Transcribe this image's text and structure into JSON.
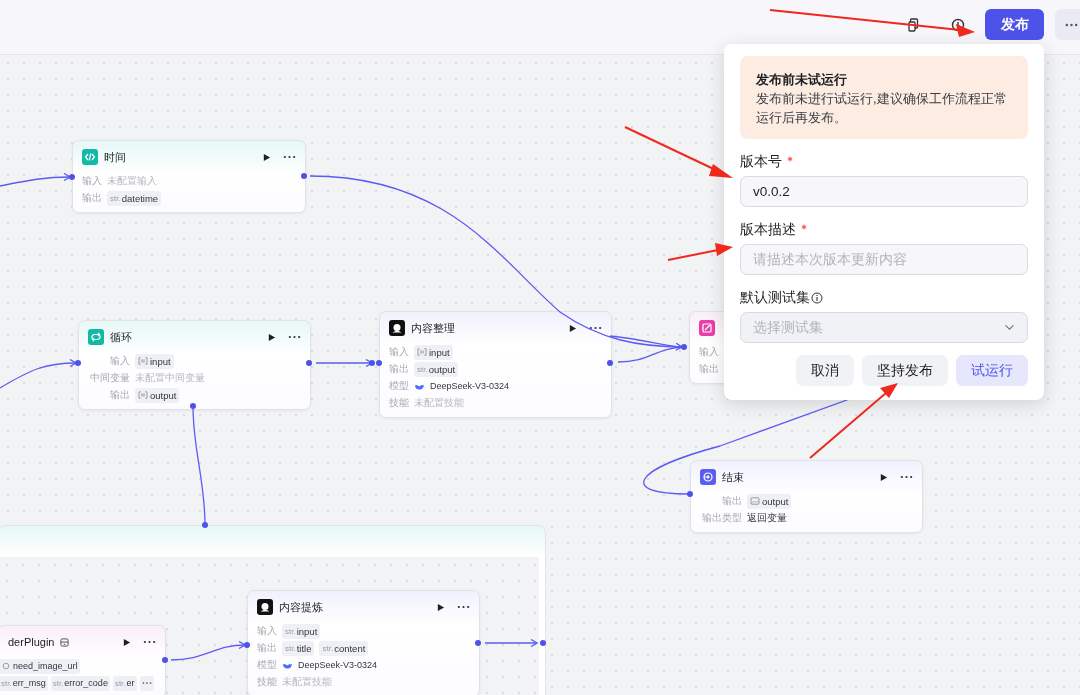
{
  "toolbar": {
    "publish_button": "发布"
  },
  "nodes": [
    {
      "kind": "code",
      "title": "时间",
      "rows": [
        {
          "label": "输入",
          "kind": "empty",
          "value": "未配置输入"
        },
        {
          "label": "输出",
          "kind": "tags",
          "tags": [
            {
              "kind": "str",
              "prefix": "str.",
              "name": "datetime"
            }
          ]
        }
      ]
    },
    {
      "kind": "loop",
      "title": "循环",
      "rows": [
        {
          "label": "输入",
          "kind": "tags",
          "tags": [
            {
              "kind": "array",
              "name": "input"
            }
          ]
        },
        {
          "label": "中间变量",
          "kind": "empty",
          "value": "未配置中间变量"
        },
        {
          "label": "输出",
          "kind": "tags",
          "tags": [
            {
              "kind": "array",
              "name": "output"
            }
          ]
        }
      ]
    },
    {
      "kind": "llm",
      "title": "内容整理",
      "rows": [
        {
          "label": "输入",
          "kind": "tags",
          "tags": [
            {
              "kind": "array",
              "name": "input"
            }
          ]
        },
        {
          "label": "输出",
          "kind": "tags",
          "tags": [
            {
              "kind": "str",
              "prefix": "str.",
              "name": "output"
            }
          ]
        },
        {
          "label": "模型",
          "kind": "model",
          "value": "DeepSeek-V3-0324"
        },
        {
          "label": "技能",
          "kind": "empty",
          "value": "未配置技能"
        }
      ]
    },
    {
      "kind": "image",
      "rows": [
        {
          "label": "输入"
        },
        {
          "label": "输出"
        }
      ]
    },
    {
      "kind": "end",
      "title": "结束",
      "rows": [
        {
          "label": "输出",
          "kind": "tags",
          "tags": [
            {
              "kind": "image",
              "name": "output"
            }
          ]
        },
        {
          "label": "输出类型",
          "kind": "text",
          "value": "返回变量"
        }
      ]
    },
    {
      "kind": "plugin",
      "title": "derPlugin",
      "rows": [
        {
          "kind": "tags",
          "tags": [
            {
              "kind": "object",
              "name": "need_image_url"
            }
          ]
        },
        {
          "kind": "tags",
          "tags": [
            {
              "kind": "str",
              "prefix": "str.",
              "name": "err_msg"
            },
            {
              "kind": "str",
              "prefix": "str.",
              "name": "error_code"
            },
            {
              "kind": "str",
              "prefix": "str.",
              "name": "er"
            },
            {
              "kind": "more"
            }
          ]
        }
      ]
    },
    {
      "kind": "llm",
      "title": "内容提炼",
      "rows": [
        {
          "label": "输入",
          "kind": "tags",
          "tags": [
            {
              "kind": "str",
              "prefix": "str.",
              "name": "input"
            }
          ]
        },
        {
          "label": "输出",
          "kind": "tags",
          "tags": [
            {
              "kind": "str",
              "prefix": "str.",
              "name": "title"
            },
            {
              "kind": "str",
              "prefix": "str.",
              "name": "content"
            }
          ]
        },
        {
          "label": "模型",
          "kind": "model",
          "value": "DeepSeek-V3-0324"
        },
        {
          "label": "技能",
          "kind": "empty",
          "value": "未配置技能"
        }
      ]
    }
  ],
  "publish_popover": {
    "alert": {
      "title": "发布前未试运行",
      "message": "发布前未进行试运行,建议确保工作流程正常运行后再发布。"
    },
    "fields": [
      {
        "kind": "input",
        "label": "版本号",
        "required": true,
        "info": false,
        "value": "v0.0.2"
      },
      {
        "kind": "textarea",
        "label": "版本描述",
        "required": true,
        "info": false,
        "placeholder": "请描述本次版本更新内容"
      },
      {
        "kind": "select",
        "label": "默认测试集",
        "required": false,
        "info": true,
        "placeholder": "选择测试集"
      }
    ],
    "buttons": [
      {
        "label": "取消",
        "primary": false
      },
      {
        "label": "坚持发布",
        "primary": false
      },
      {
        "label": "试运行",
        "primary": true
      }
    ]
  }
}
